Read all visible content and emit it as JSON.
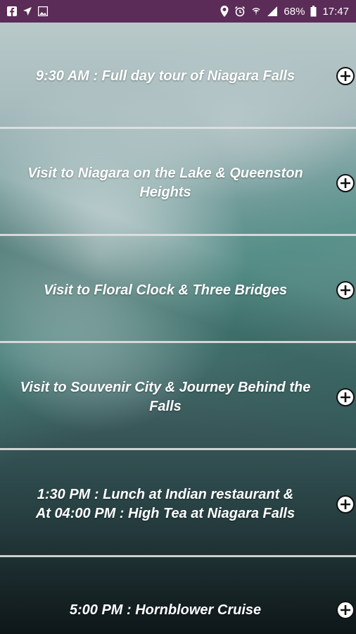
{
  "status_bar": {
    "battery": "68%",
    "time": "17:47",
    "left_icons": [
      "facebook-icon",
      "navigation-icon",
      "image-icon"
    ],
    "right_icons": [
      "location-icon",
      "alarm-icon",
      "wifi-icon",
      "signal-icon",
      "battery-icon"
    ]
  },
  "itinerary": {
    "items": [
      {
        "label": "9:30 AM : Full day tour of Niagara Falls",
        "icon": "plus-circle-icon"
      },
      {
        "label": "Visit to Niagara on the Lake & Queenston\nHeights",
        "icon": "plus-circle-icon"
      },
      {
        "label": "Visit to Floral Clock & Three Bridges",
        "icon": "plus-circle-icon"
      },
      {
        "label": "Visit to Souvenir City & Journey Behind the\nFalls",
        "icon": "plus-circle-icon"
      },
      {
        "label": "1:30 PM : Lunch at Indian restaurant &\nAt 04:00 PM :  High Tea at Niagara Falls",
        "icon": "plus-circle-icon"
      },
      {
        "label": "5:00 PM : Hornblower Cruise",
        "icon": "plus-circle-icon"
      }
    ]
  },
  "colors": {
    "status_bar": "#5a2c57",
    "text": "#ffffff",
    "divider": "#e1e1e1"
  }
}
